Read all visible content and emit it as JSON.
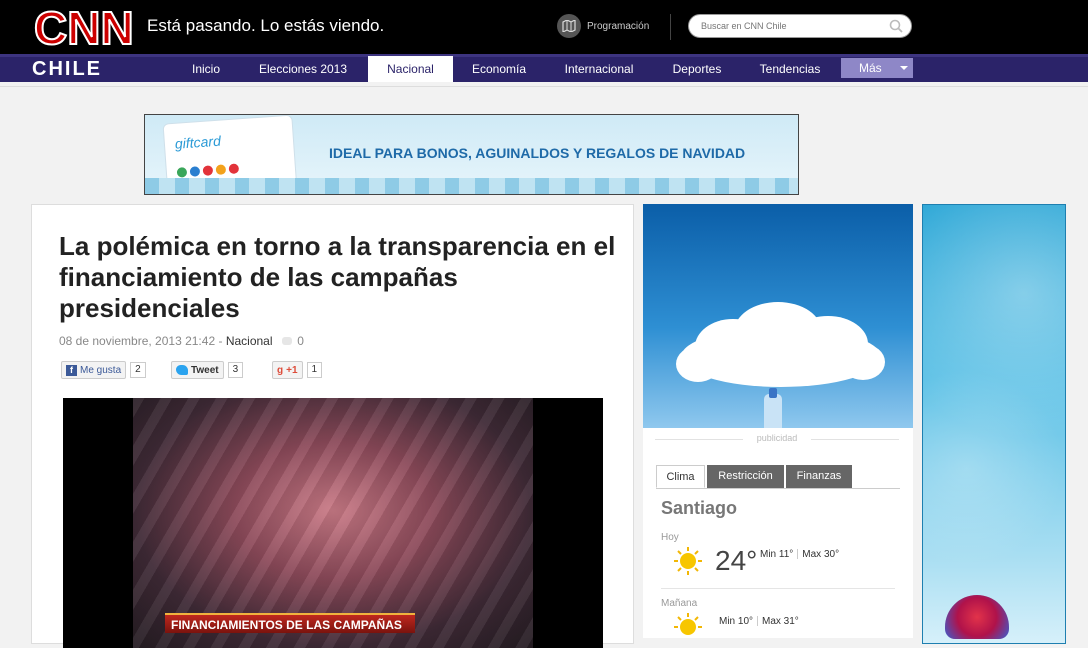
{
  "header": {
    "logo_text": "CNN",
    "logo_sub": "CHILE",
    "slogan": "Está pasando. Lo estás viendo.",
    "programacion": "Programación",
    "search_placeholder": "Buscar en CNN Chile"
  },
  "nav": {
    "items": [
      "Inicio",
      "Elecciones 2013",
      "Nacional",
      "Economía",
      "Internacional",
      "Deportes",
      "Tendencias"
    ],
    "active": "Nacional",
    "more": "Más"
  },
  "banner": {
    "card_text": "giftcard",
    "text": "IDEAL PARA BONOS, AGUINALDOS Y REGALOS DE NAVIDAD"
  },
  "article": {
    "title": "La polémica en torno a la transparencia en el financiamiento de las campañas presidenciales",
    "date": "08 de noviembre, 2013 21:42",
    "section": "Nacional",
    "comments": "0",
    "share": {
      "like_label": "Me gusta",
      "like_count": "2",
      "tweet_label": "Tweet",
      "tweet_count": "3",
      "gplus_label": "+1",
      "gplus_count": "1"
    },
    "video_caption": "FINANCIAMIENTOS DE LAS CAMPAÑAS"
  },
  "sidebar": {
    "ad_label": "publicidad",
    "tabs": [
      "Clima",
      "Restricción",
      "Finanzas"
    ],
    "active_tab": "Clima",
    "city": "Santiago",
    "today": {
      "label": "Hoy",
      "temp": "24°",
      "min": "Min 11°",
      "max": "Max 30°"
    },
    "tomorrow": {
      "label": "Mañana",
      "min": "Min 10°",
      "max": "Max 31°"
    }
  },
  "colors": {
    "nav_bg": "#2b2369",
    "more_bg": "#8e87c7",
    "logo_red": "#cc0000"
  }
}
